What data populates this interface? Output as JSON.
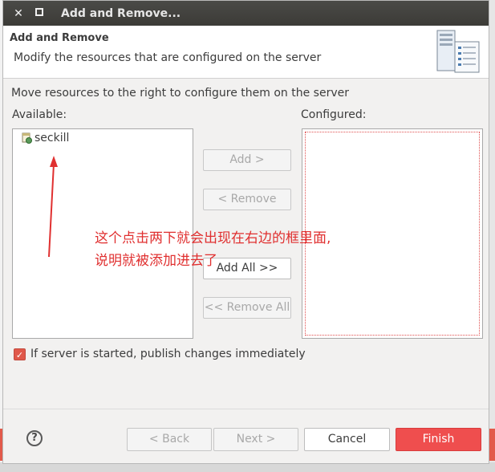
{
  "window": {
    "title": "Add and Remove...",
    "close_glyph": "✕"
  },
  "header": {
    "title": "Add and Remove",
    "description": "Modify the resources that are configured on the server",
    "icon": "server-icon"
  },
  "instruction": "Move resources to the right to configure them on the server",
  "available": {
    "label": "Available:",
    "items": [
      {
        "label": "seckill",
        "icon": "web-project-icon"
      }
    ]
  },
  "configured": {
    "label": "Configured:",
    "items": []
  },
  "buttons": {
    "add": "Add >",
    "remove": "< Remove",
    "add_all": "Add All >>",
    "remove_all": "<< Remove All"
  },
  "annotation": {
    "line1": "这个点击两下就会出现在右边的框里面,",
    "line2": "说明就被添加进去了",
    "color": "#e03030"
  },
  "publish_checkbox": {
    "label": "If server is started, publish changes immediately",
    "checked": true
  },
  "footer": {
    "help": "?",
    "back": "< Back",
    "next": "Next >",
    "cancel": "Cancel",
    "finish": "Finish"
  },
  "colors": {
    "accent": "#ef4e4e",
    "titlebar": "#3c3b37"
  }
}
